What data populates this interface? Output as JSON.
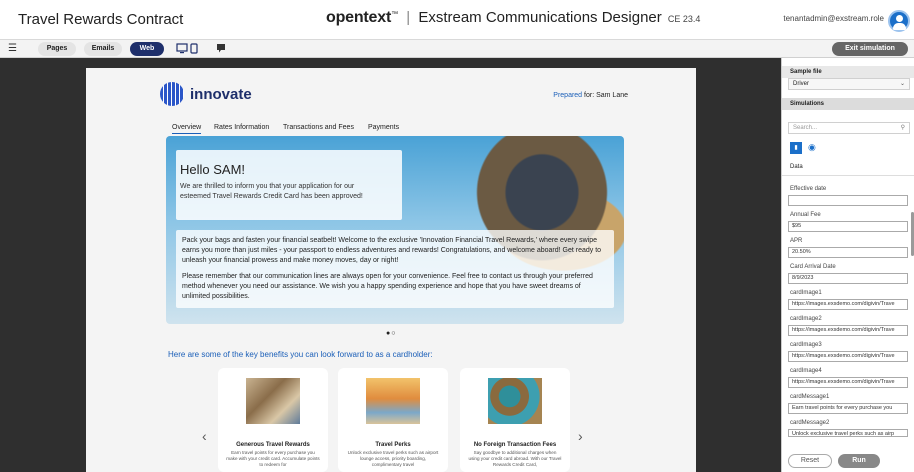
{
  "header": {
    "app_title": "Travel Rewards Contract",
    "brand_logo": "opentext",
    "brand_tm": "™",
    "brand_separator": "|",
    "brand_product": "Exstream Communications Designer",
    "brand_version": "CE 23.4",
    "user": "tenantadmin@exstream.role"
  },
  "toolbar": {
    "menu_icon": "☰",
    "buttons": [
      "Pages",
      "Emails",
      "Web"
    ],
    "active_button": "Web",
    "exit_label": "Exit simulation"
  },
  "page": {
    "logo_text": "innovate",
    "prepared_label": "Prepared",
    "prepared_rest": " for: Sam Lane",
    "tabs": [
      "Overview",
      "Rates Information",
      "Transactions and Fees",
      "Payments"
    ],
    "hello": "Hello SAM!",
    "hero_p1": "We are thrilled to inform you that your application for our esteemed Travel Rewards Credit Card has been approved!",
    "hero_p2": "Pack your bags and fasten your financial seatbelt! Welcome to the exclusive 'Innovation Financial Travel Rewards,' where every swipe earns you more than just miles - your passport to endless adventures and rewards! Congratulations, and welcome aboard! Get ready to unleash your financial prowess and make money moves, day or night!",
    "hero_p3": "Please remember that our communication lines are always open for your convenience. Feel free to contact us through your preferred method whenever you need our assistance. We wish you a happy spending experience and hope that you have sweet dreams of unlimited possibilities.",
    "carousel_dots": "●○",
    "benefits_title": "Here are some of the key benefits you can look forward to as a cardholder:",
    "arrow_left": "‹",
    "arrow_right": "›",
    "cards": [
      {
        "title": "Generous Travel Rewards",
        "desc": "Earn travel points for every purchase you make with your credit card. Accumulate points to redeem for"
      },
      {
        "title": "Travel Perks",
        "desc": "Unlock exclusive travel perks such as airport lounge access, priority boarding, complimentary travel"
      },
      {
        "title": "No Foreign Transaction Fees",
        "desc": "Say goodbye to additional charges when using your credit card abroad. With our Travel Rewards Credit Card,"
      }
    ]
  },
  "sidebar": {
    "sample_file_label": "Sample file",
    "sample_file_value": "Driver",
    "simulations_label": "Simulations",
    "search_placeholder": "Search...",
    "data_label": "Data",
    "fields": [
      {
        "label": "Effective date",
        "value": ""
      },
      {
        "label": "Annual Fee",
        "value": "$95"
      },
      {
        "label": "APR",
        "value": "20.50%"
      },
      {
        "label": "Card Arrival Date",
        "value": "8/9/2023"
      },
      {
        "label": "cardImage1",
        "value": "https://images.exsdemo.com/digivin/Trave"
      },
      {
        "label": "cardImage2",
        "value": "https://images.exsdemo.com/digivin/Trave"
      },
      {
        "label": "cardImage3",
        "value": "https://images.exsdemo.com/digivin/Trave"
      },
      {
        "label": "cardImage4",
        "value": "https://images.exsdemo.com/digivin/Trave"
      },
      {
        "label": "cardMessage1",
        "value": "Earn travel points for every purchase you"
      },
      {
        "label": "cardMessage2",
        "value": "Unlock exclusive travel perks such as airp"
      }
    ],
    "reset_label": "Reset",
    "run_label": "Run"
  }
}
